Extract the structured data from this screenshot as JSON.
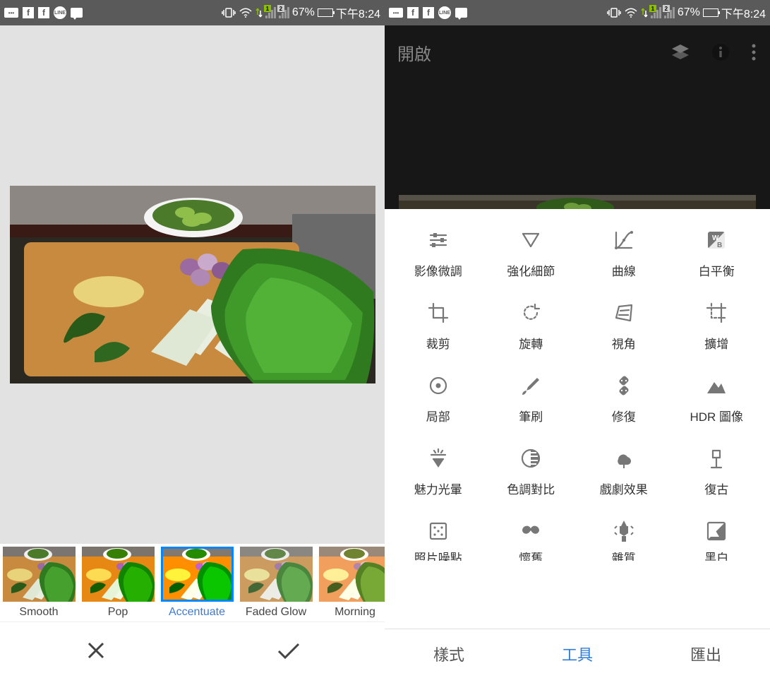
{
  "status_bar": {
    "battery_percent": "67%",
    "time": "下午8:24",
    "sim1": "1",
    "sim2": "2",
    "line_text": "LINE",
    "dots_text": "•••"
  },
  "left": {
    "filters": [
      {
        "label": "Smooth",
        "selected": false
      },
      {
        "label": "Pop",
        "selected": false
      },
      {
        "label": "Accentuate",
        "selected": true
      },
      {
        "label": "Faded Glow",
        "selected": false
      },
      {
        "label": "Morning",
        "selected": false
      }
    ]
  },
  "right": {
    "app_bar_title": "開啟",
    "tools": [
      {
        "name": "影像微調",
        "icon": "tune"
      },
      {
        "name": "強化細節",
        "icon": "triangle-down"
      },
      {
        "name": "曲線",
        "icon": "curves"
      },
      {
        "name": "白平衡",
        "icon": "wb"
      },
      {
        "name": "裁剪",
        "icon": "crop"
      },
      {
        "name": "旋轉",
        "icon": "rotate"
      },
      {
        "name": "視角",
        "icon": "perspective"
      },
      {
        "name": "擴增",
        "icon": "expand"
      },
      {
        "name": "局部",
        "icon": "target"
      },
      {
        "name": "筆刷",
        "icon": "brush"
      },
      {
        "name": "修復",
        "icon": "heal"
      },
      {
        "name": "HDR 圖像",
        "icon": "hdr"
      },
      {
        "name": "魅力光暈",
        "icon": "glow"
      },
      {
        "name": "色調對比",
        "icon": "tonal"
      },
      {
        "name": "戲劇效果",
        "icon": "drama"
      },
      {
        "name": "復古",
        "icon": "vintage"
      },
      {
        "name": "照片噪點",
        "icon": "grainy",
        "cutoff": true
      },
      {
        "name": "懷舊",
        "icon": "mustache",
        "cutoff": true
      },
      {
        "name": "雜質",
        "icon": "grunge",
        "cutoff": true
      },
      {
        "name": "黑白",
        "icon": "bw",
        "cutoff": true
      }
    ],
    "tabs": [
      {
        "label": "樣式",
        "active": false
      },
      {
        "label": "工具",
        "active": true
      },
      {
        "label": "匯出",
        "active": false
      }
    ]
  }
}
